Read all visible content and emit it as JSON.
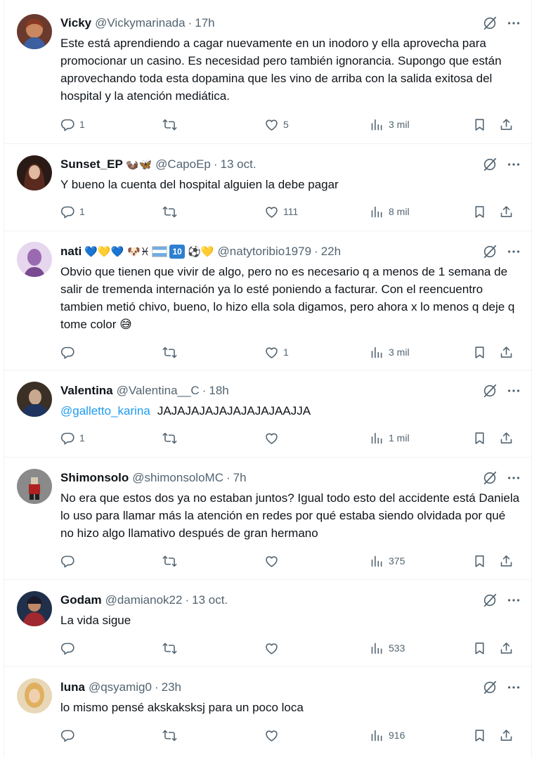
{
  "icons": {
    "reply": "reply-icon",
    "retweet": "retweet-icon",
    "like": "heart-icon",
    "views": "views-icon",
    "bookmark": "bookmark-icon",
    "share": "share-icon",
    "grok": "grok-icon",
    "more": "more-icon"
  },
  "colors": {
    "text": "#0f1419",
    "muted": "#536471",
    "link": "#1d9bf0",
    "divider": "#eff3f4"
  },
  "tweets": [
    {
      "name": "Vicky",
      "name_emoji": "",
      "handle": "@Vickymarinada",
      "dot": "·",
      "time": "17h",
      "mention": "",
      "text": "Este está aprendiendo a cagar nuevamente en un inodoro y ella aprovecha para promocionar un casino. Es necesidad pero también ignorancia. Supongo que están aprovechando toda esta dopamina que les vino de arriba con la salida exitosa del hospital y la atención mediática.",
      "replies": "1",
      "retweets": "",
      "likes": "5",
      "views": "3 mil"
    },
    {
      "name": "Sunset_EP",
      "name_emoji": "🦦🦋",
      "handle": "@CapoEp",
      "dot": "·",
      "time": "13 oct.",
      "mention": "",
      "text": "Y bueno la cuenta del hospital alguien la debe pagar",
      "replies": "1",
      "retweets": "",
      "likes": "111",
      "views": "8 mil"
    },
    {
      "name": "nati",
      "name_emoji": "💙💛💙 🐶♓",
      "handle": "@natytoribio1979",
      "dot": "·",
      "time": "22h",
      "mention": "",
      "text": "Obvio que tienen que vivir de algo, pero no es necesario q a menos de 1 semana de salir de tremenda internación ya lo esté poniendo a facturar. Con el reencuentro tambien metió chivo, bueno, lo hizo ella sola digamos, pero ahora x lo menos q deje q tome color 😅",
      "replies": "",
      "retweets": "",
      "likes": "1",
      "views": "3 mil"
    },
    {
      "name": "Valentina",
      "name_emoji": "",
      "handle": "@Valentina__C",
      "dot": "·",
      "time": "18h",
      "mention": "@galletto_karina",
      "text": "JAJAJAJAJAJAJAJAJAAJJA",
      "replies": "1",
      "retweets": "",
      "likes": "",
      "views": "1 mil"
    },
    {
      "name": "Shimonsolo",
      "name_emoji": "",
      "handle": "@shimonsoloMC",
      "dot": "·",
      "time": "7h",
      "mention": "",
      "text": "No era que estos dos ya no estaban juntos? Igual todo esto del accidente está Daniela lo uso para llamar más la atención en redes por qué estaba siendo olvidada por qué no hizo algo llamativo después de gran hermano",
      "replies": "",
      "retweets": "",
      "likes": "",
      "views": "375"
    },
    {
      "name": "Godam",
      "name_emoji": "",
      "handle": "@damianok22",
      "dot": "·",
      "time": "13 oct.",
      "mention": "",
      "text": "La vida sigue",
      "replies": "",
      "retweets": "",
      "likes": "",
      "views": "533"
    },
    {
      "name": "luna",
      "name_emoji": "",
      "handle": "@qsyamig0",
      "dot": "·",
      "time": "23h",
      "mention": "",
      "text": "lo mismo pensé akskaksksj para un poco loca",
      "replies": "",
      "retweets": "",
      "likes": "",
      "views": "916"
    }
  ],
  "nati_extra": {
    "ten_badge": "10",
    "tail_emoji": "⚽💛"
  }
}
